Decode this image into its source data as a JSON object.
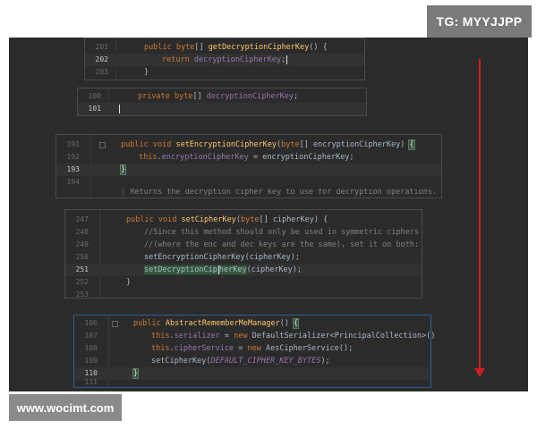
{
  "overlay": {
    "tg_label": "TG: MYYJJPP",
    "watermark": "www.wocimt.com"
  },
  "colors": {
    "editor_bg": "#2b2b2b",
    "keyword": "#cc7832",
    "method": "#ffc66d",
    "field": "#9876aa",
    "comment": "#808080",
    "arrow": "#d11f1f"
  },
  "snippets": [
    {
      "name": "getDecryptionCipherKey",
      "lines": [
        {
          "num": "201",
          "code": "public byte[] getDecryptionCipherKey() {"
        },
        {
          "num": "202",
          "code": "return decryptionCipherKey;"
        },
        {
          "num": "203",
          "code": "}"
        }
      ]
    },
    {
      "name": "decryptionCipherKey-field",
      "lines": [
        {
          "num": "100",
          "code": "private byte[] decryptionCipherKey;"
        },
        {
          "num": "101",
          "code": ""
        }
      ]
    },
    {
      "name": "setEncryptionCipherKey",
      "lines": [
        {
          "num": "191",
          "code": "public void setEncryptionCipherKey(byte[] encryptionCipherKey) {"
        },
        {
          "num": "192",
          "code": "this.encryptionCipherKey = encryptionCipherKey;"
        },
        {
          "num": "193",
          "code": "}"
        },
        {
          "num": "194",
          "code": ""
        },
        {
          "num": "",
          "code": "Returns the decryption cipher key to use for decryption operations."
        }
      ]
    },
    {
      "name": "setCipherKey",
      "lines": [
        {
          "num": "247",
          "code": "public void setCipherKey(byte[] cipherKey) {"
        },
        {
          "num": "248",
          "code": "//Since this method should only be used in symmetric ciphers"
        },
        {
          "num": "249",
          "code": "//(where the enc and dec keys are the same), set it on both:"
        },
        {
          "num": "250",
          "code": "setEncryptionCipherKey(cipherKey);"
        },
        {
          "num": "251",
          "code": "setDecryptionCipherKey(cipherKey);"
        },
        {
          "num": "252",
          "code": "}"
        },
        {
          "num": "253",
          "code": ""
        }
      ]
    },
    {
      "name": "AbstractRememberMeManager",
      "lines": [
        {
          "num": "106",
          "code": "public AbstractRememberMeManager() {"
        },
        {
          "num": "107",
          "code": "this.serializer = new DefaultSerializer<PrincipalCollection>()"
        },
        {
          "num": "108",
          "code": "this.cipherService = new AesCipherService();"
        },
        {
          "num": "109",
          "code": "setCipherKey(DEFAULT_CIPHER_KEY_BYTES);"
        },
        {
          "num": "110",
          "code": "}"
        },
        {
          "num": "111",
          "code": ""
        }
      ]
    }
  ]
}
